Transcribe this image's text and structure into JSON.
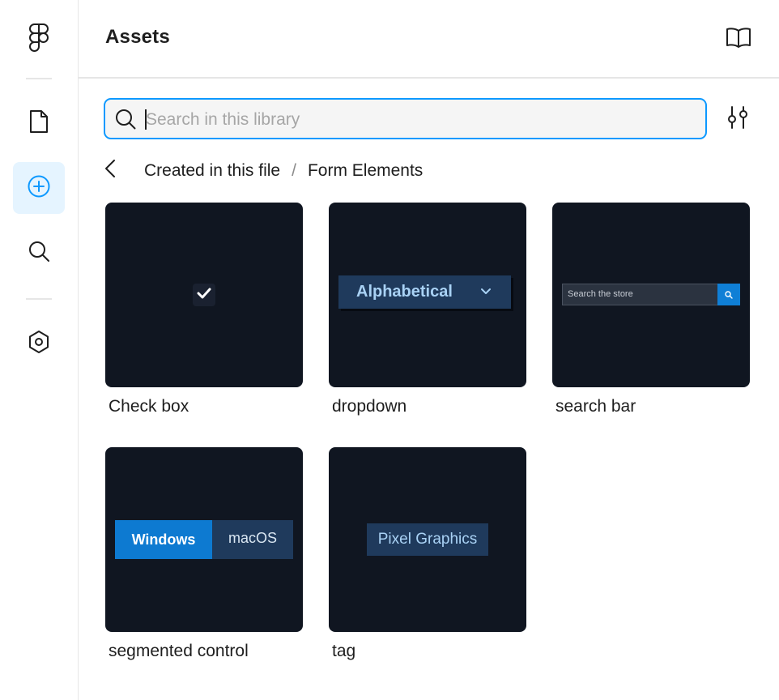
{
  "rail": {
    "items": [
      {
        "icon": "figma-logo-icon"
      },
      {
        "icon": "file-icon"
      },
      {
        "icon": "add-circle-icon",
        "active": true
      },
      {
        "icon": "search-icon"
      },
      {
        "icon": "plugin-hexagon-icon"
      }
    ],
    "accent_color": "#0d99ff",
    "active_bg": "#e5f4ff"
  },
  "header": {
    "title": "Assets",
    "book_icon": "book-icon"
  },
  "search": {
    "placeholder": "Search in this library",
    "value": ""
  },
  "breadcrumb": {
    "parent": "Created in this file",
    "separator": "/",
    "current": "Form Elements"
  },
  "components": [
    {
      "label": "Check box",
      "thumbnail": {
        "kind": "checkbox"
      }
    },
    {
      "label": "dropdown",
      "thumbnail": {
        "kind": "dropdown",
        "text": "Alphabetical"
      }
    },
    {
      "label": "search bar",
      "thumbnail": {
        "kind": "search",
        "text": "Search the store"
      }
    },
    {
      "label": "segmented control",
      "thumbnail": {
        "kind": "segmented",
        "options": [
          "Windows",
          "macOS"
        ]
      }
    },
    {
      "label": "tag",
      "thumbnail": {
        "kind": "tag",
        "text": "Pixel Graphics"
      }
    }
  ],
  "colors": {
    "card_bg": "#101621",
    "thumb_navy": "#1f3a5c",
    "thumb_blue": "#0d7ad1",
    "focus_border": "#0d99ff"
  }
}
